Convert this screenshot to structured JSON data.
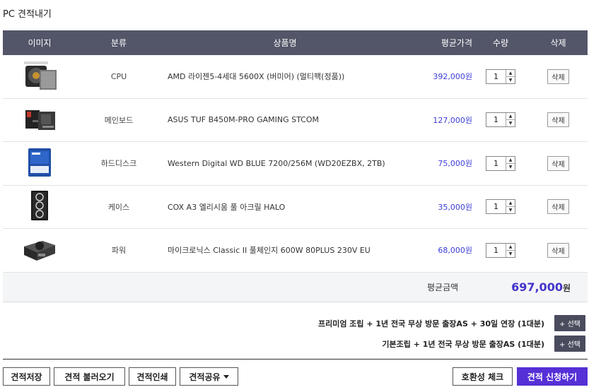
{
  "page_title": "PC 견적내기",
  "table": {
    "headers": {
      "image": "이미지",
      "category": "분류",
      "product": "상품명",
      "price": "평균가격",
      "qty": "수량",
      "delete": "삭제"
    },
    "rows": [
      {
        "category": "CPU",
        "product": "AMD 라이젠5-4세대 5600X (버미어) (멀티팩(정품))",
        "price": "392,000원",
        "qty": "1",
        "delete_label": "삭제",
        "thumb": "cpu-icon"
      },
      {
        "category": "메인보드",
        "product": "ASUS TUF B450M-PRO GAMING STCOM",
        "price": "127,000원",
        "qty": "1",
        "delete_label": "삭제",
        "thumb": "motherboard-icon"
      },
      {
        "category": "하드디스크",
        "product": "Western Digital WD BLUE 7200/256M (WD20EZBX, 2TB)",
        "price": "75,000원",
        "qty": "1",
        "delete_label": "삭제",
        "thumb": "hdd-icon"
      },
      {
        "category": "케이스",
        "product": "COX A3 엘리시움 풀 아크릴 HALO",
        "price": "35,000원",
        "qty": "1",
        "delete_label": "삭제",
        "thumb": "case-icon"
      },
      {
        "category": "파워",
        "product": "마이크로닉스 Classic II 풀체인지 600W 80PLUS 230V EU",
        "price": "68,000원",
        "qty": "1",
        "delete_label": "삭제",
        "thumb": "psu-icon"
      }
    ],
    "total_label": "평균금액",
    "total_amount": "697,000",
    "total_unit": "원"
  },
  "options": [
    {
      "label": "프리미엄 조립 + 1년 전국 무상 방문 출장AS + 30일 연장 (1대분)",
      "button": "+ 선택"
    },
    {
      "label": "기본조립 + 1년 전국 무상 방문 출장AS (1대분)",
      "button": "+ 선택"
    }
  ],
  "footer": {
    "save": "견적저장",
    "load": "견적 불러오기",
    "print": "견적인쇄",
    "share": "견적공유",
    "compat": "호환성 체크",
    "apply": "견적 신청하기"
  },
  "colors": {
    "header_bg": "#535568",
    "price": "#3b3bd8",
    "total": "#4334c9",
    "primary": "#5530d6"
  }
}
